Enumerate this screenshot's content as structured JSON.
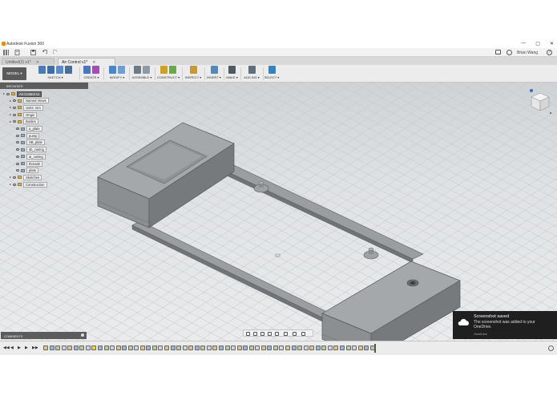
{
  "window": {
    "title": "Autodesk Fusion 360",
    "controls": [
      "—",
      "▢",
      "✕"
    ]
  },
  "appbar": {
    "user": "Brian Wang",
    "help": "?",
    "data_panel_icon": "grid-icon",
    "file_icon": "file-icon",
    "save_icon": "save-icon",
    "undo_icon": "undo-icon",
    "redo_icon": "redo-icon"
  },
  "tabs": [
    {
      "label": "Untitled(2) v1*",
      "close": "✕",
      "active": false
    },
    {
      "label": "Air Control v1*",
      "close": "✕",
      "active": true
    }
  ],
  "toolbar": {
    "workspace": "MODEL ▾",
    "groups": [
      {
        "label": "SKETCH ▾",
        "colors": [
          "#4a7ab8",
          "#3d6ea6",
          "#5a8acb",
          "#486f9a"
        ]
      },
      {
        "label": "CREATE ▾",
        "colors": [
          "#4c76c2",
          "#a14fb3"
        ]
      },
      {
        "label": "MODIFY ▾",
        "colors": [
          "#4a86c9",
          "#6f9ed6"
        ]
      },
      {
        "label": "ASSEMBLE ▾",
        "colors": [
          "#6b7b8c",
          "#8f9aa6"
        ]
      },
      {
        "label": "CONSTRUCT ▾",
        "colors": [
          "#d29d2a",
          "#6aa84f"
        ]
      },
      {
        "label": "INSPECT ▾",
        "colors": [
          "#c79b2f"
        ]
      },
      {
        "label": "INSERT ▾",
        "colors": [
          "#4c8bc0"
        ]
      },
      {
        "label": "MAKE ▾",
        "colors": [
          "#505a66"
        ]
      },
      {
        "label": "ADD-INS ▾",
        "colors": [
          "#5e6f81"
        ]
      },
      {
        "label": "SELECT ▾",
        "colors": [
          "#2f86c6"
        ]
      }
    ]
  },
  "browser": {
    "title": "BROWSER",
    "items": [
      {
        "label": "Air Control v1",
        "indent": 0,
        "type": "root"
      },
      {
        "label": "Named Views",
        "indent": 1,
        "type": "folder"
      },
      {
        "label": "Units: mm",
        "indent": 1,
        "type": "doc"
      },
      {
        "label": "Origin",
        "indent": 1,
        "type": "folder"
      },
      {
        "label": "Bodies",
        "indent": 1,
        "type": "folder"
      },
      {
        "label": "a_plate",
        "indent": 2,
        "type": "body"
      },
      {
        "label": "pump",
        "indent": 2,
        "type": "body"
      },
      {
        "label": "SB_plate",
        "indent": 2,
        "type": "body"
      },
      {
        "label": "sb_casing",
        "indent": 2,
        "type": "body"
      },
      {
        "label": "ai_casing",
        "indent": 2,
        "type": "body"
      },
      {
        "label": "threads",
        "indent": 2,
        "type": "body"
      },
      {
        "label": "plate",
        "indent": 2,
        "type": "body"
      },
      {
        "label": "Sketches",
        "indent": 1,
        "type": "folder"
      },
      {
        "label": "Construction",
        "indent": 1,
        "type": "folder"
      }
    ]
  },
  "viewcube": {
    "faces": [
      "TOP",
      "FRONT",
      "RIGHT"
    ]
  },
  "comments": {
    "label": "COMMENTS"
  },
  "toast": {
    "title": "Screenshot saved",
    "message": "The screenshot was added to your OneDrive.",
    "source": "OneDrive"
  },
  "timeline": {
    "feature_count": 55,
    "controls": [
      "first",
      "prev",
      "play",
      "next",
      "last"
    ]
  },
  "colors": {
    "toolbar_bg": "#ececec",
    "viewport_top": "#cfd3d6",
    "model_face": "#8c9093",
    "model_top": "#a2a6a9",
    "model_side": "#6f7376"
  }
}
